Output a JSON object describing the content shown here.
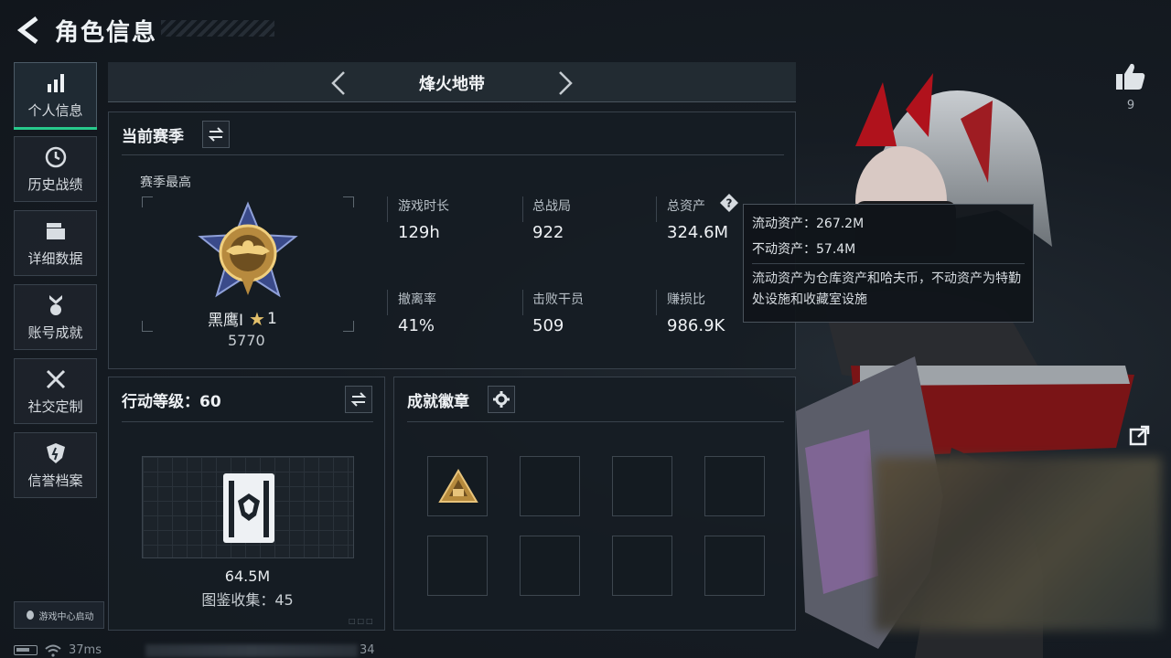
{
  "header": {
    "title": "角色信息"
  },
  "sidebar": {
    "items": [
      {
        "label": "个人信息",
        "icon": "bar-chart-icon",
        "active": true
      },
      {
        "label": "历史战绩",
        "icon": "clock-icon"
      },
      {
        "label": "详细数据",
        "icon": "folder-icon"
      },
      {
        "label": "账号成就",
        "icon": "medal-icon"
      },
      {
        "label": "社交定制",
        "icon": "tools-icon"
      },
      {
        "label": "信誉档案",
        "icon": "shield-icon"
      }
    ],
    "launch_label": "游戏中心启动"
  },
  "status": {
    "ping": "37ms",
    "uid_tail": "34"
  },
  "mode": {
    "name": "烽火地带"
  },
  "season": {
    "title": "当前赛季",
    "best_label": "赛季最高",
    "rank_name": "黑鹰Ⅰ",
    "rank_stars": "1",
    "rank_score": "5770",
    "stats": [
      {
        "label": "游戏时长",
        "value": "129h"
      },
      {
        "label": "总战局",
        "value": "922"
      },
      {
        "label": "总资产",
        "value": "324.6M"
      },
      {
        "label": "撤离率",
        "value": "41%"
      },
      {
        "label": "击败干员",
        "value": "509"
      },
      {
        "label": "赚损比",
        "value": "986.9K"
      }
    ]
  },
  "tooltip": {
    "liquid": "流动资产：267.2M",
    "fixed": "不动资产：57.4M",
    "desc": "流动资产为仓库资产和哈夫币，不动资产为特勤处设施和收藏室设施"
  },
  "level": {
    "title": "行动等级：60",
    "value": "64.5M",
    "collection": "图鉴收集：45"
  },
  "achievements": {
    "title": "成就徽章",
    "slots_filled": 1,
    "slots_total": 8
  },
  "social": {
    "likes": "9"
  },
  "colors": {
    "accent": "#27c98c",
    "panel": "#161c23",
    "border": "#38414b"
  }
}
